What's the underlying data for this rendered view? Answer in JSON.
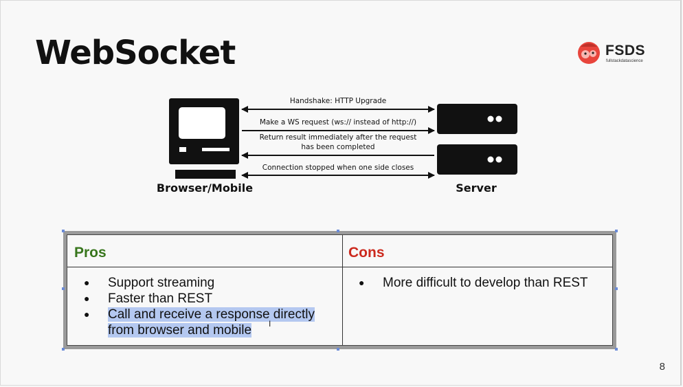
{
  "slide": {
    "title": "WebSocket",
    "page_number": "8"
  },
  "logo": {
    "brand": "FSDS",
    "tagline": "fullstackdatascience",
    "icon": "mascot-icon"
  },
  "diagram": {
    "client_label": "Browser/Mobile",
    "server_label": "Server",
    "arrows": [
      {
        "label": "Handshake: HTTP Upgrade",
        "direction": "both"
      },
      {
        "label": "Make a WS request (ws:// instead of http://)",
        "direction": "to-server"
      },
      {
        "label_line1": "Return result immediately after the request",
        "label_line2": "has been completed",
        "direction": "to-client"
      },
      {
        "label": "Connection stopped when one side closes",
        "direction": "both"
      }
    ]
  },
  "table": {
    "pros_header": "Pros",
    "cons_header": "Cons",
    "pros": [
      "Support streaming",
      "Faster than REST",
      "Call and receive a response directly",
      "from browser and mobile"
    ],
    "cons": [
      "More difficult to develop than REST"
    ],
    "bullet": "●",
    "colors": {
      "pros": "#38761d",
      "cons": "#cc2a1e",
      "selection": "#b4c8f0"
    }
  }
}
